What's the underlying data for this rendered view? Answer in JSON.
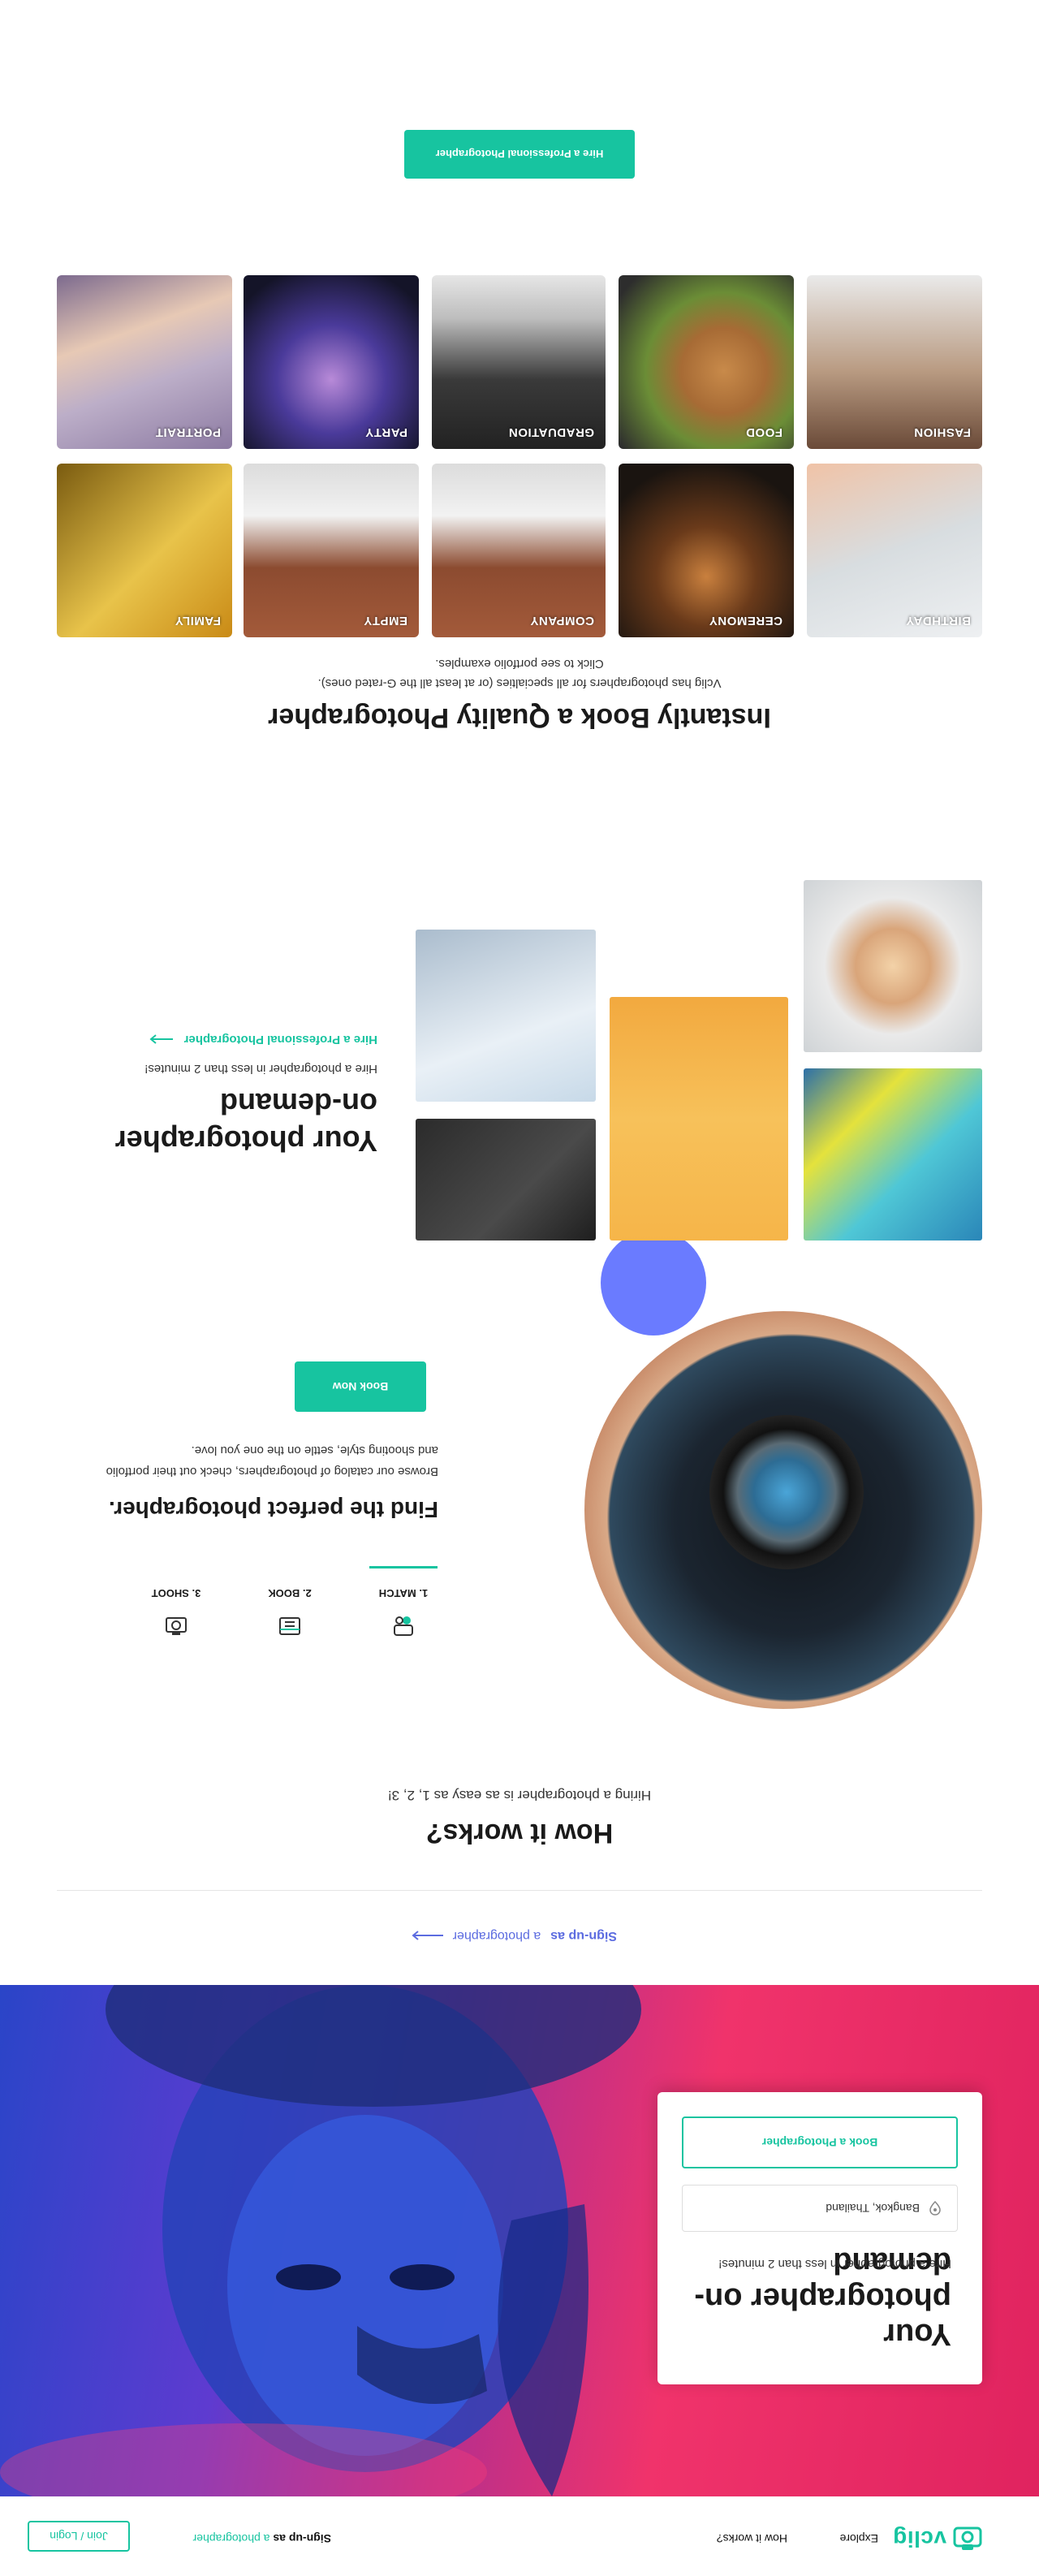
{
  "nav": {
    "logo": "vclig",
    "explore": "Explore",
    "how_it_works": "How it works?",
    "signup_bold": "Sign-up as",
    "signup_accent": "a photographer",
    "join": "Join / Login"
  },
  "hero": {
    "title": "Your photographer on-demand",
    "subtitle": "Hire a photographer in less than 2 minutes!",
    "location_value": "Bangkok, Thailand",
    "button": "Book a Photographer"
  },
  "signup_as": {
    "bold": "Sign-up as",
    "accent": "a photographer"
  },
  "how": {
    "title": "How it works?",
    "subtitle": "Hiring a photographer is as easy as 1, 2, 3!",
    "steps": [
      {
        "label": "1. MATCH",
        "icon": "match-icon"
      },
      {
        "label": "2. BOOK",
        "icon": "calendar-icon"
      },
      {
        "label": "3. SHOOT",
        "icon": "camera-icon"
      }
    ],
    "find_title": "Find the perfect photographer.",
    "find_desc": "Browse our catalog of photographers, check out their portfolio and shooting style, settle on the one you love.",
    "button": "Book Now"
  },
  "ondemand": {
    "title": "Your photographer on-demand",
    "subtitle": "Hire a photographer in less than 2 minutes!",
    "link": "Hire a Professional Photographer"
  },
  "instant": {
    "title": "Instantly Book a Quality Photographer",
    "subtitle": "Vclig has photographers for all specialties (or at least all the G-rated ones). Click to see portfolio examples."
  },
  "categories": [
    {
      "label": "BIRTHDAY"
    },
    {
      "label": "CEREMONY"
    },
    {
      "label": "COMPANY"
    },
    {
      "label": "EMPTY"
    },
    {
      "label": "FAMILY"
    },
    {
      "label": "FASHION"
    },
    {
      "label": "FOOD"
    },
    {
      "label": "GRADUATION"
    },
    {
      "label": "PARTY"
    },
    {
      "label": "PORTRAIT"
    }
  ],
  "cta": {
    "button": "Hire a Professional Photographer"
  },
  "colors": {
    "accent": "#17c4a0",
    "indigo": "#5c6ce0",
    "dot": "#6a7bff"
  }
}
